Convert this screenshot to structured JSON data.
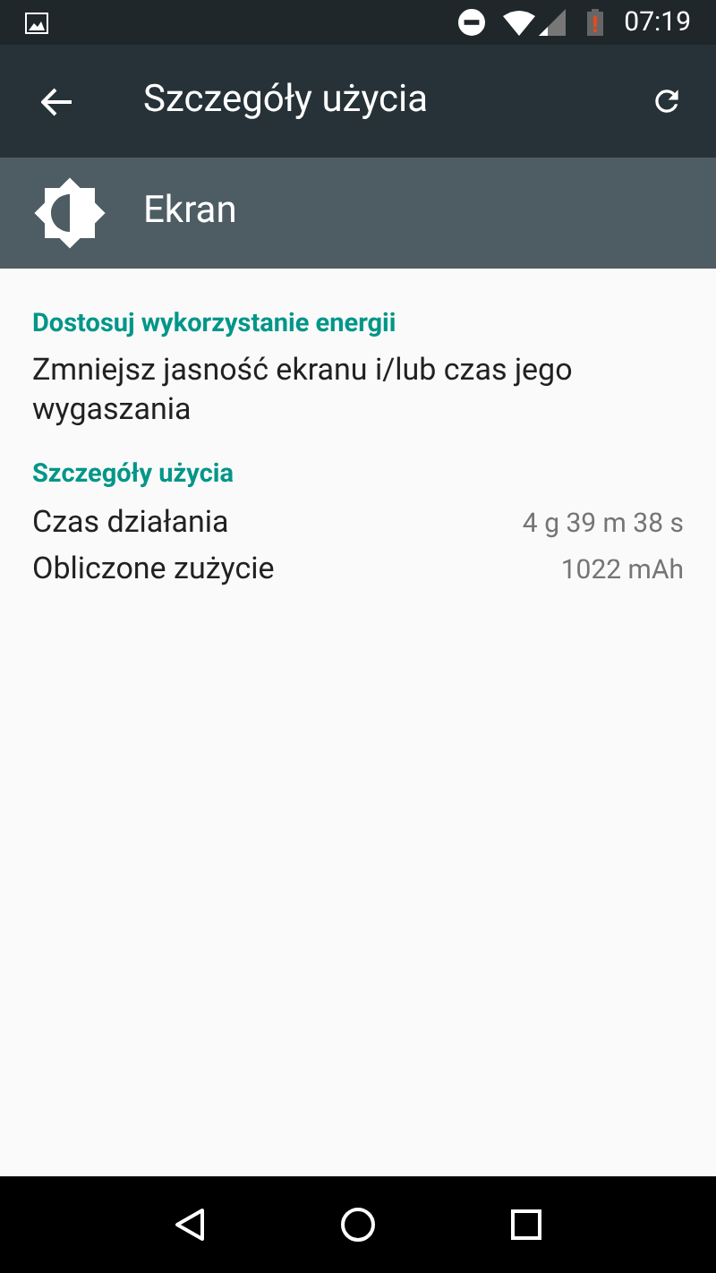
{
  "status_bar": {
    "time": "07:19"
  },
  "toolbar": {
    "title": "Szczegóły użycia"
  },
  "header": {
    "title": "Ekran"
  },
  "sections": [
    {
      "title": "Dostosuj wykorzystanie energii",
      "kind": "text",
      "text": "Zmniejsz jasność ekranu i/lub czas jego wygaszania"
    },
    {
      "title": "Szczegóły użycia",
      "kind": "rows",
      "rows": [
        {
          "label": "Czas działania",
          "value": "4 g 39 m 38 s"
        },
        {
          "label": "Obliczone zużycie",
          "value": "1022 mAh"
        }
      ]
    }
  ]
}
